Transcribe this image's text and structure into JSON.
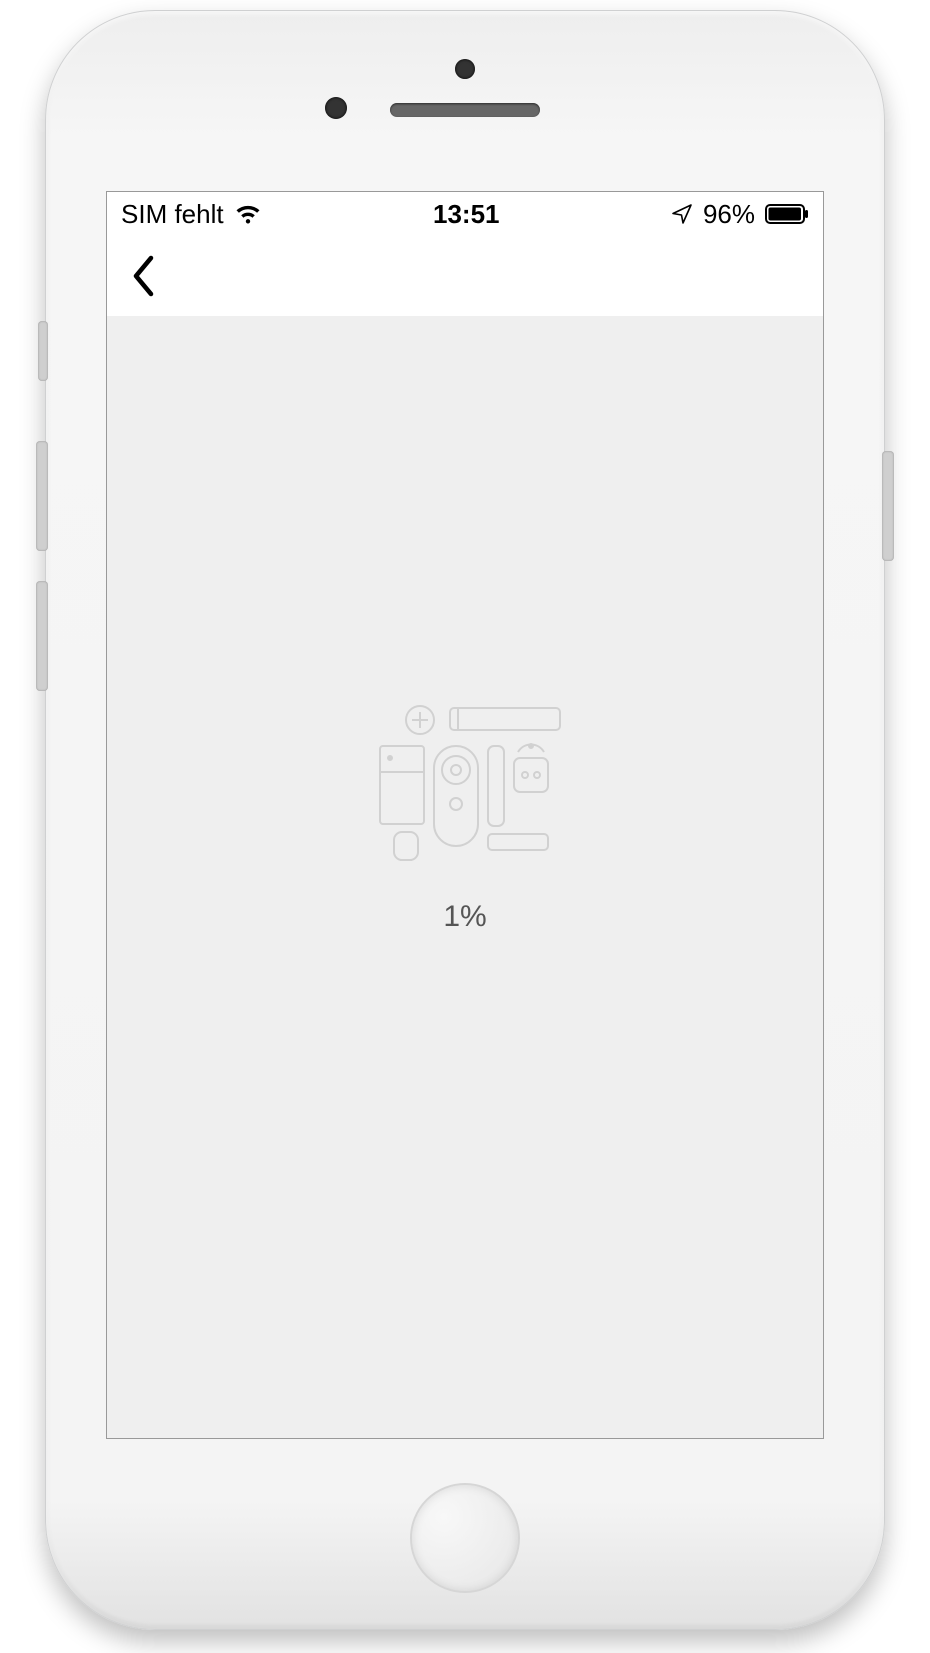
{
  "status_bar": {
    "sim_label": "SIM fehlt",
    "time": "13:51",
    "battery_percent": "96%"
  },
  "content": {
    "progress_text": "1%"
  },
  "icons": {
    "wifi": "wifi-icon",
    "location": "location-arrow-icon",
    "battery": "battery-icon",
    "back": "chevron-left-icon",
    "devices": "devices-illustration"
  }
}
